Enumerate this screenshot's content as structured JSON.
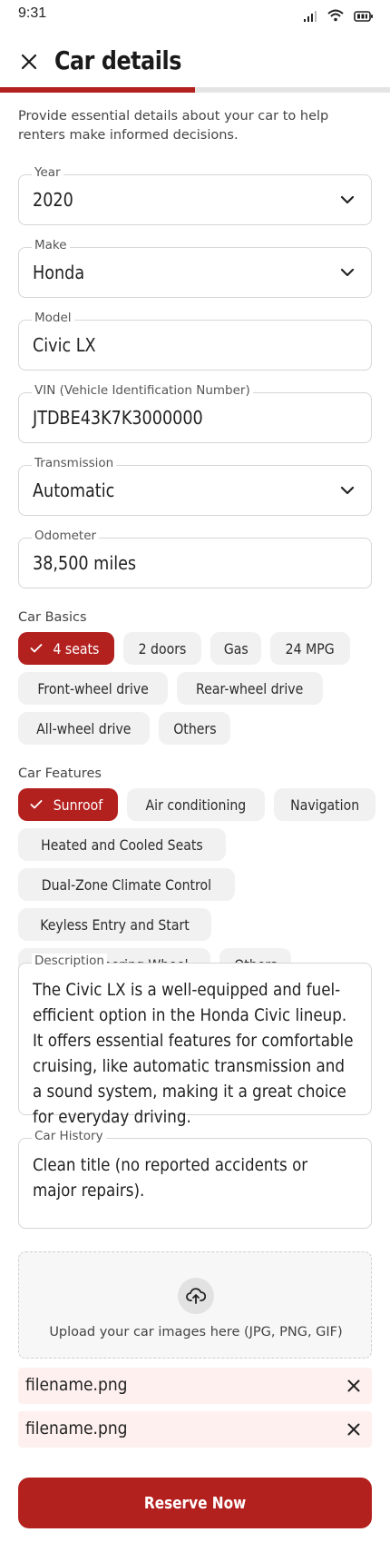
{
  "status_bar": {
    "time": "9:31"
  },
  "header": {
    "title": "Car details",
    "progress": 0.5
  },
  "intro": "Provide essential details about your car to help renters make informed decisions.",
  "fields": {
    "year": {
      "label": "Year",
      "value": "2020"
    },
    "make": {
      "label": "Make",
      "value": "Honda"
    },
    "model": {
      "label": "Model",
      "value": "Civic LX"
    },
    "vin": {
      "label": "VIN (Vehicle Identification Number)",
      "value": "JTDBE43K7K3000000"
    },
    "transmission": {
      "label": "Transmission",
      "value": "Automatic"
    },
    "odometer": {
      "label": "Odometer",
      "value": "38,500 miles"
    }
  },
  "car_basics": {
    "label": "Car Basics",
    "chips": [
      {
        "label": "4 seats",
        "selected": true
      },
      {
        "label": "2 doors",
        "selected": false
      },
      {
        "label": "Gas",
        "selected": false
      },
      {
        "label": "24 MPG",
        "selected": false
      },
      {
        "label": "Front-wheel drive",
        "selected": false
      },
      {
        "label": "Rear-wheel drive",
        "selected": false
      },
      {
        "label": "All-wheel drive",
        "selected": false
      },
      {
        "label": "Others",
        "selected": false
      }
    ]
  },
  "car_features": {
    "label": "Car Features",
    "chips": [
      {
        "label": "Sunroof",
        "selected": true
      },
      {
        "label": "Air conditioning",
        "selected": false
      },
      {
        "label": "Navigation",
        "selected": false
      },
      {
        "label": "Heated and Cooled Seats",
        "selected": false
      },
      {
        "label": "Dual-Zone Climate Control",
        "selected": false
      },
      {
        "label": "Keyless Entry and Start",
        "selected": false
      },
      {
        "label": "Heated Steering Wheel",
        "selected": false
      },
      {
        "label": "Others",
        "selected": false
      }
    ]
  },
  "description": {
    "label": "Description",
    "value": "The Civic LX is a well-equipped and fuel-efficient option in the Honda Civic lineup. It offers essential features for comfortable cruising, like automatic transmission and a sound system, making it a great choice for everyday driving."
  },
  "car_history": {
    "label": "Car History",
    "value": "Clean title (no reported accidents or major repairs)."
  },
  "upload": {
    "text": "Upload your car images here (JPG, PNG, GIF)"
  },
  "files": [
    {
      "name": "filename.png"
    },
    {
      "name": "filename.png"
    }
  ],
  "reserve_button": "Reserve Now",
  "colors": {
    "accent": "#b3211f",
    "file_bg": "#fdf0ee",
    "chip_bg": "#f1f1f1"
  }
}
